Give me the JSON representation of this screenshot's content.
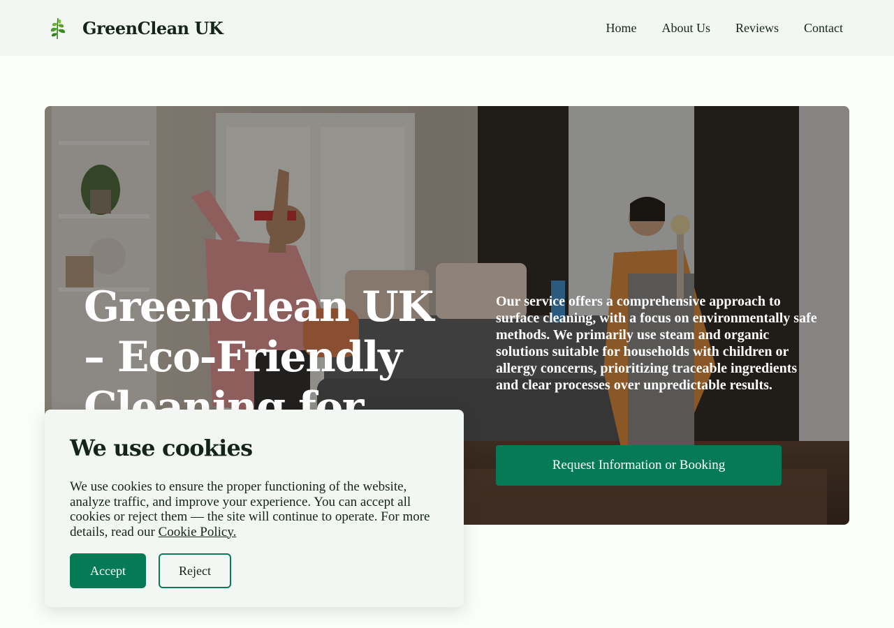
{
  "brand": {
    "name": "GreenClean UK",
    "icon": "leaf-icon",
    "accent": "#067a55"
  },
  "nav": {
    "items": [
      {
        "label": "Home"
      },
      {
        "label": "About Us"
      },
      {
        "label": "Reviews"
      },
      {
        "label": "Contact"
      }
    ]
  },
  "hero": {
    "title": "GreenClean UK – Eco-Friendly Cleaning for",
    "description": "Our service offers a comprehensive approach to surface cleaning, with a focus on environmentally safe methods. We primarily use steam and organic solutions suitable for households with children or allergy concerns, prioritizing traceable ingredients and clear processes over unpredictable results.",
    "cta_label": "Request Information or Booking"
  },
  "cookie": {
    "title": "We use cookies",
    "text": "We use cookies to ensure the proper functioning of the website, analyze traffic, and improve your experience. You can accept all cookies or reject them — the site will continue to operate. For more details, read our ",
    "link_label": "Cookie Policy.",
    "accept_label": "Accept",
    "reject_label": "Reject"
  }
}
